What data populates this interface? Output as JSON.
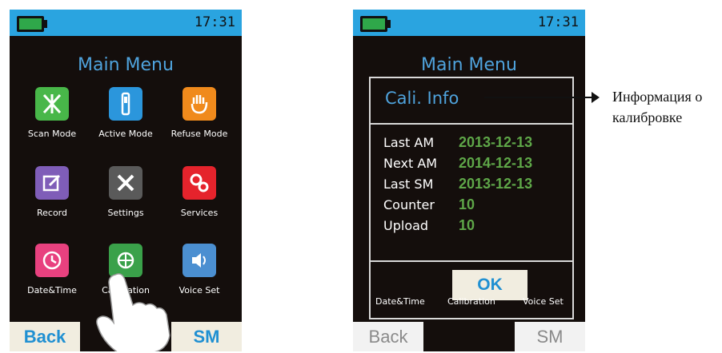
{
  "left_screen": {
    "time": "17:31",
    "title": "Main Menu",
    "tiles": [
      {
        "label": "Scan Mode",
        "icon": "scan-icon",
        "color": "#48b749"
      },
      {
        "label": "Active Mode",
        "icon": "active-mode-icon",
        "color": "#2b96dc"
      },
      {
        "label": "Refuse Mode",
        "icon": "refuse-hand-icon",
        "color": "#f08a1c"
      },
      {
        "label": "Record",
        "icon": "record-edit-icon",
        "color": "#7f5db8"
      },
      {
        "label": "Settings",
        "icon": "tools-icon",
        "color": "#5a5a5a"
      },
      {
        "label": "Services",
        "icon": "gears-icon",
        "color": "#e5232c"
      },
      {
        "label": "Date&Time",
        "icon": "clock-icon",
        "color": "#e8417f"
      },
      {
        "label": "Calibration",
        "icon": "calibration-icon",
        "color": "#3aa14a"
      },
      {
        "label": "Voice Set",
        "icon": "speaker-icon",
        "color": "#4b8fd1"
      }
    ],
    "back_label": "Back",
    "sm_label": "SM"
  },
  "right_screen": {
    "time": "17:31",
    "title": "Main Menu",
    "dialog": {
      "title": "Cali. Info",
      "rows": [
        {
          "key": "Last AM",
          "value": "2013-12-13"
        },
        {
          "key": "Next AM",
          "value": "2014-12-13"
        },
        {
          "key": "Last SM",
          "value": "2013-12-13"
        },
        {
          "key": "Counter",
          "value": "10"
        },
        {
          "key": "Upload",
          "value": "10"
        }
      ],
      "ok_label": "OK"
    },
    "bottom_labels": [
      "Date&Time",
      "Calibration",
      "Voice Set"
    ],
    "back_label": "Back",
    "sm_label": "SM"
  },
  "annotation": {
    "line1": "Информация о",
    "line2": "калибровке"
  }
}
